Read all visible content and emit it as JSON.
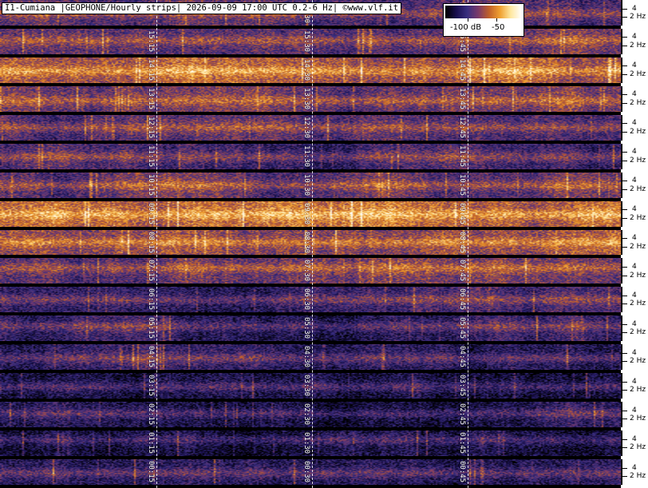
{
  "header": {
    "title": "I1-Cumiana |GEOPHONE/Hourly strips| 2026-09-09 17:00 UTC 0.2-6 Hz| ©www.vlf.it"
  },
  "legend": {
    "low_label": "-100 dB",
    "high_label": "-50",
    "colors": [
      "#000000",
      "#1a1050",
      "#3a2f80",
      "#7a3a6a",
      "#c0602a",
      "#f0a030",
      "#ffe8a0",
      "#ffffff"
    ]
  },
  "axis": {
    "label_4": "4",
    "label_2": "2 Hz"
  },
  "strips": [
    {
      "hour": "16",
      "labels": [
        "16",
        "16:30",
        "16:45"
      ],
      "intensity": 0.55
    },
    {
      "hour": "15",
      "labels": [
        "15:15",
        "15:30",
        "15:45"
      ],
      "intensity": 0.6
    },
    {
      "hour": "14",
      "labels": [
        "14:15",
        "14:30",
        "14:45"
      ],
      "intensity": 0.85
    },
    {
      "hour": "13",
      "labels": [
        "13:15",
        "13:30",
        "13:45"
      ],
      "intensity": 0.65
    },
    {
      "hour": "12",
      "labels": [
        "12:15",
        "12:30",
        "12:45"
      ],
      "intensity": 0.55
    },
    {
      "hour": "11",
      "labels": [
        "11:15",
        "11:30",
        "11:45"
      ],
      "intensity": 0.5
    },
    {
      "hour": "10",
      "labels": [
        "10:15",
        "10:30",
        "10:45"
      ],
      "intensity": 0.6
    },
    {
      "hour": "09",
      "labels": [
        "09:15",
        "09:30",
        "09:45"
      ],
      "intensity": 0.9
    },
    {
      "hour": "08",
      "labels": [
        "08:15",
        "08:30",
        "08:45"
      ],
      "intensity": 0.75
    },
    {
      "hour": "07",
      "labels": [
        "07:15",
        "07:30",
        "07:45"
      ],
      "intensity": 0.6
    },
    {
      "hour": "06",
      "labels": [
        "06:15",
        "06:30",
        "06:45"
      ],
      "intensity": 0.45
    },
    {
      "hour": "05",
      "labels": [
        "05:15",
        "05:30",
        "05:45"
      ],
      "intensity": 0.45
    },
    {
      "hour": "04",
      "labels": [
        "04:15",
        "04:30",
        "04:45"
      ],
      "intensity": 0.35
    },
    {
      "hour": "03",
      "labels": [
        "03:15",
        "03:30",
        "03:45"
      ],
      "intensity": 0.3
    },
    {
      "hour": "02",
      "labels": [
        "02:15",
        "02:30",
        "02:45"
      ],
      "intensity": 0.3
    },
    {
      "hour": "01",
      "labels": [
        "01:15",
        "01:30",
        "01:45"
      ],
      "intensity": 0.28
    },
    {
      "hour": "00",
      "labels": [
        "00:15",
        "00:30",
        "00:45"
      ],
      "intensity": 0.4
    }
  ]
}
